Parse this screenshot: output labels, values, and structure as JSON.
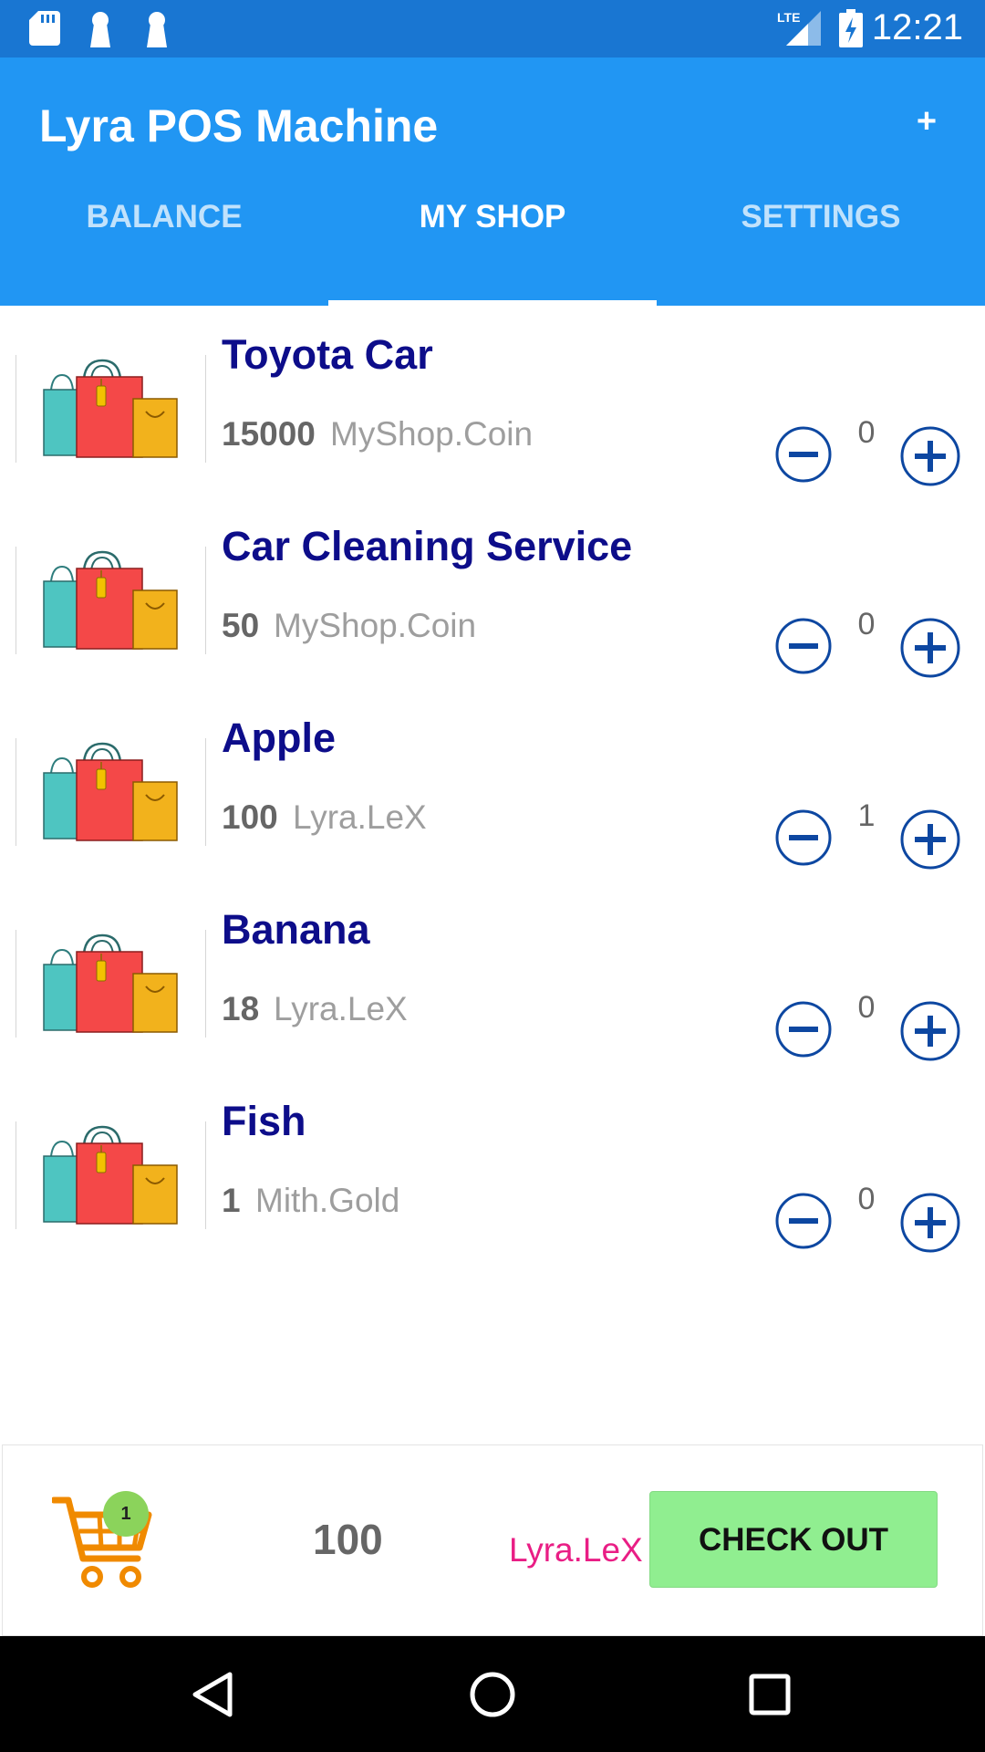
{
  "status_bar": {
    "time": "12:21",
    "network_label": "LTE",
    "icons": [
      "sd-card-icon",
      "notification-icon",
      "notification-icon",
      "lte-signal-icon",
      "battery-charging-icon"
    ]
  },
  "app_bar": {
    "title": "Lyra POS Machine",
    "add_label": "+",
    "tabs": [
      {
        "label": "BALANCE",
        "active": false
      },
      {
        "label": "MY SHOP",
        "active": true
      },
      {
        "label": "SETTINGS",
        "active": false
      }
    ]
  },
  "products": [
    {
      "name": "Toyota Car",
      "price": "15000",
      "currency": "MyShop.Coin",
      "quantity": "0"
    },
    {
      "name": "Car Cleaning Service",
      "price": "50",
      "currency": "MyShop.Coin",
      "quantity": "0"
    },
    {
      "name": "Apple",
      "price": "100",
      "currency": "Lyra.LeX",
      "quantity": "1"
    },
    {
      "name": "Banana",
      "price": "18",
      "currency": "Lyra.LeX",
      "quantity": "0"
    },
    {
      "name": "Fish",
      "price": "1",
      "currency": "Mith.Gold",
      "quantity": "0"
    }
  ],
  "cart": {
    "badge_count": "1",
    "total": "100",
    "currency": "Lyra.LeX",
    "checkout_label": "CHECK OUT"
  },
  "colors": {
    "status_bar": "#1976d2",
    "app_bar": "#2196f3",
    "product_name": "#0d0d8a",
    "stepper": "#0d47a1",
    "checkout_button": "#90ee90",
    "cart_currency": "#e91e85",
    "cart_icon": "#f08a00"
  }
}
